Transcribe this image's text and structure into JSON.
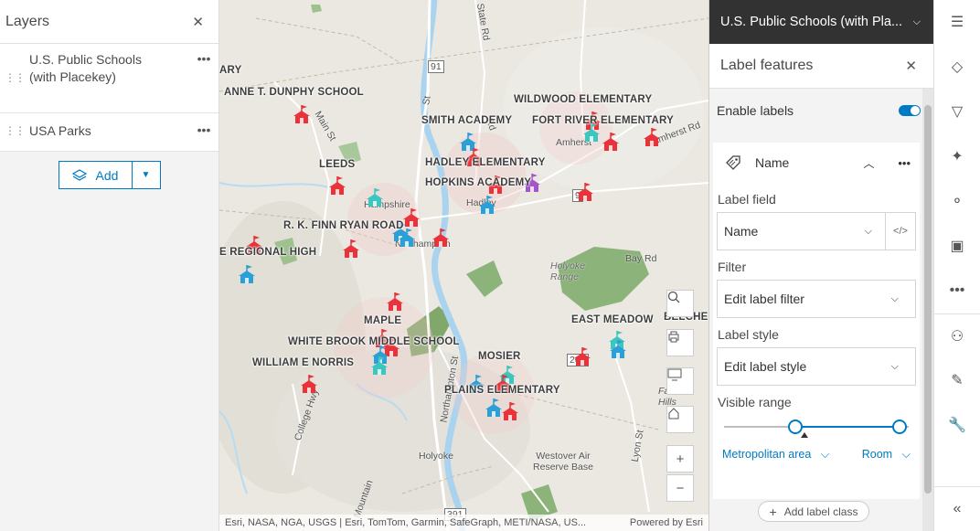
{
  "layers_panel": {
    "title": "Layers",
    "items": [
      {
        "label": "U.S. Public Schools (with Placekey)"
      },
      {
        "label": "USA Parks"
      }
    ],
    "add_label": "Add"
  },
  "map": {
    "school_labels": [
      "ANNE T. DUNPHY SCHOOL",
      "WILDWOOD ELEMENTARY",
      "SMITH ACADEMY",
      "FORT RIVER ELEMENTARY",
      "LEEDS",
      "HADLEY ELEMENTARY",
      "HOPKINS ACADEMY",
      "R. K. FINN RYAN ROAD",
      "E REGIONAL HIGH",
      "MAPLE",
      "WHITE BROOK MIDDLE SCHOOL",
      "WILLIAM E NORRIS",
      "MOSIER",
      "PLAINS ELEMENTARY",
      "EAST MEADOW",
      "BELCHE",
      "ARY"
    ],
    "place_labels": [
      "Holyoke Range",
      "Holyoke",
      "Northampton",
      "Hadley",
      "Amherst",
      "Westover Air Reserve Base",
      "Hampshire",
      "Bay Rd",
      "Amherst Rd",
      "Main St",
      "Northampton St",
      "College Hwy",
      "State Rd",
      "Lyon St",
      "Falls Hills",
      "Mountain",
      "Rd",
      "St",
      "91",
      "391",
      "202",
      "9"
    ],
    "attribution": "Esri, NASA, NGA, USGS | Esri, TomTom, Garmin, SafeGraph, METI/NASA, US...",
    "powered_by": "Powered by Esri",
    "colors": {
      "red_pin": "#e8333a",
      "blue_pin": "#2b9fd6",
      "teal_pin": "#3cc6c0",
      "purple_pin": "#a355c9",
      "park": "#7fa86a"
    }
  },
  "label_panel": {
    "layer_title": "U.S. Public Schools (with Pla...",
    "title": "Label features",
    "enable_labels": "Enable labels",
    "class_name": "Name",
    "label_field_label": "Label field",
    "label_field_value": "Name",
    "filter_label": "Filter",
    "filter_value": "Edit label filter",
    "style_label": "Label style",
    "style_value": "Edit label style",
    "visible_range_label": "Visible range",
    "range_min": "Metropolitan area",
    "range_max": "Room",
    "add_label_class": "Add label class",
    "accent": "#007ac2"
  },
  "toolbar": {
    "icons": [
      "properties-icon",
      "styles-icon",
      "filter-icon",
      "effects-icon",
      "clustering-icon",
      "popups-icon",
      "more-icon",
      "fields-icon",
      "sketch-icon",
      "settings-icon",
      "collapse-icon"
    ]
  }
}
